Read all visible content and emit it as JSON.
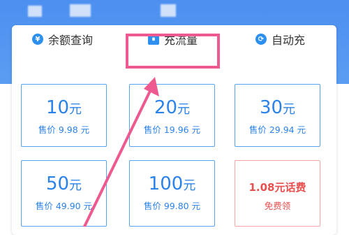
{
  "tabs": [
    {
      "label": "余额查询",
      "icon": "yen-icon"
    },
    {
      "label": "充流量",
      "icon": "data-bars-icon"
    },
    {
      "label": "自动充",
      "icon": "refresh-icon"
    }
  ],
  "cards": [
    {
      "amount": "10",
      "unit": "元",
      "price": "售价 9.98 元"
    },
    {
      "amount": "20",
      "unit": "元",
      "price": "售价 19.96 元"
    },
    {
      "amount": "30",
      "unit": "元",
      "price": "售价 29.94 元"
    },
    {
      "amount": "50",
      "unit": "元",
      "price": "售价 49.90 元"
    },
    {
      "amount": "100",
      "unit": "元",
      "price": "售价 99.80 元"
    },
    {
      "promo": "1.08元话费",
      "action": "免费领"
    }
  ],
  "colors": {
    "primary": "#2b83ea",
    "header": "#4c8ff0",
    "highlight": "#ee5a8f",
    "promo": "#e84f4f"
  }
}
